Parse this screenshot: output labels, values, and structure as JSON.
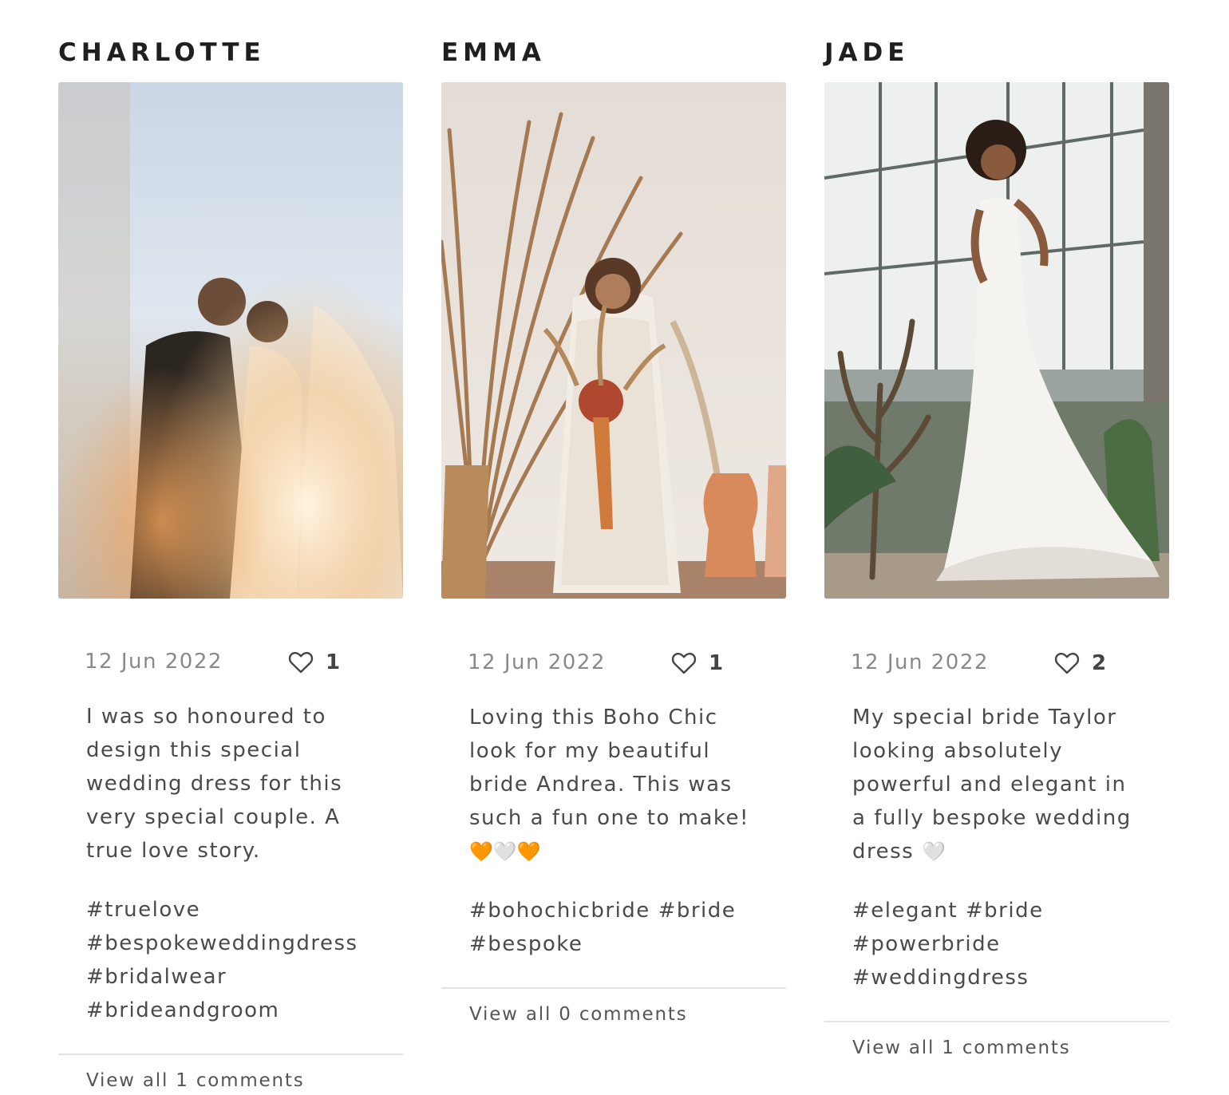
{
  "posts": [
    {
      "author": "CHARLOTTE",
      "date": "12 Jun 2022",
      "likes": "1",
      "caption": "I was so honoured to design this special wedding dress for this very special couple. A true love story.",
      "hashtags": [
        "#truelove",
        "#bespokeweddingdress",
        "#bridalwear",
        "#brideandgroom"
      ],
      "comments_link": "View all 1 comments",
      "photo_icon": "couple-veil-sunset-photo"
    },
    {
      "author": "EMMA",
      "date": "12 Jun 2022",
      "likes": "1",
      "caption": "Loving this Boho Chic look for my beautiful bride Andrea. This was such a fun one to make!",
      "caption_emoji": [
        "🧡",
        "🤍",
        "🧡"
      ],
      "hashtags": [
        "#bohochicbride",
        "#bride",
        "#bespoke"
      ],
      "comments_link": "View all 0 comments",
      "photo_icon": "boho-bride-pampas-photo"
    },
    {
      "author": "JADE",
      "date": "12 Jun 2022",
      "likes": "2",
      "caption": "My special bride Taylor looking absolutely powerful and elegant in a fully bespoke wedding dress",
      "caption_emoji": [
        "🤍"
      ],
      "hashtags": [
        "#elegant",
        "#bride",
        "#powerbride",
        "#weddingdress"
      ],
      "comments_link": "View all 1 comments",
      "photo_icon": "bride-greenhouse-photo"
    }
  ],
  "colors": {
    "accent_orange": "#f27d1b",
    "text": "#4a4a4a",
    "muted": "#8a8a8a",
    "divider": "#e3e3e3"
  }
}
